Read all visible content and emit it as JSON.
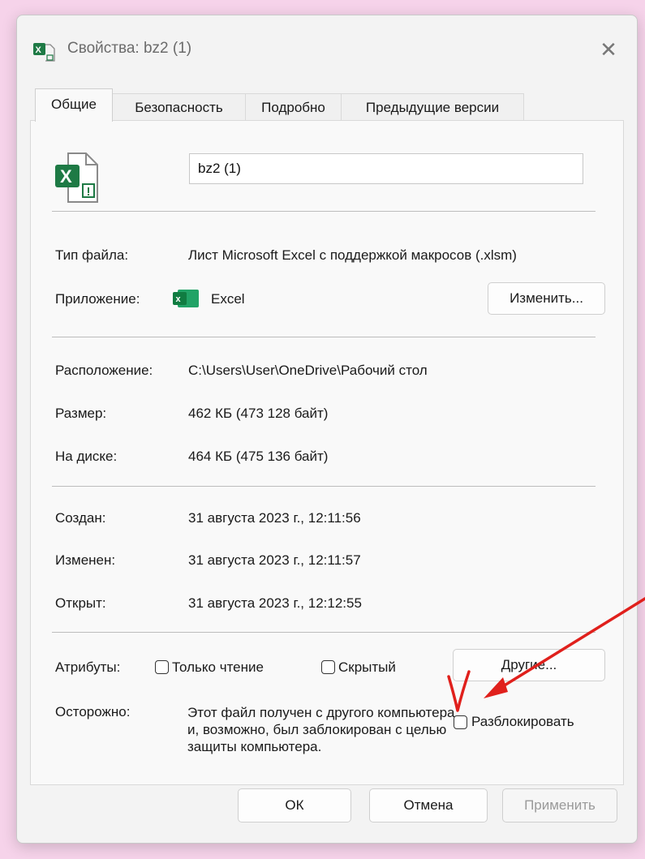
{
  "window": {
    "title": "Свойства: bz2 (1)",
    "close_glyph": "✕"
  },
  "tabs": [
    {
      "label": "Общие",
      "active": true
    },
    {
      "label": "Безопасность",
      "active": false
    },
    {
      "label": "Подробно",
      "active": false
    },
    {
      "label": "Предыдущие версии",
      "active": false
    }
  ],
  "general": {
    "file_name": "bz2 (1)",
    "file_type_label": "Тип файла:",
    "file_type_value": "Лист Microsoft Excel с поддержкой макросов (.xlsm)",
    "app_label": "Приложение:",
    "app_value": "Excel",
    "change_button": "Изменить...",
    "location_label": "Расположение:",
    "location_value": "C:\\Users\\User\\OneDrive\\Рабочий стол",
    "size_label": "Размер:",
    "size_value": "462 КБ (473 128 байт)",
    "disk_label": "На диске:",
    "disk_value": "464 КБ (475 136 байт)",
    "created_label": "Создан:",
    "created_value": "31 августа 2023 г., 12:11:56",
    "modified_label": "Изменен:",
    "modified_value": "31 августа 2023 г., 12:11:57",
    "opened_label": "Открыт:",
    "opened_value": "31 августа 2023 г., 12:12:55",
    "attributes_label": "Атрибуты:",
    "readonly_label": "Только чтение",
    "hidden_label": "Скрытый",
    "other_button": "Другие...",
    "warning_label": "Осторожно:",
    "warning_text": "Этот файл получен с другого компьютера и, возможно, был заблокирован с целью защиты компьютера.",
    "unblock_label": "Разблокировать"
  },
  "footer": {
    "ok": "ОК",
    "cancel": "Отмена",
    "apply": "Применить"
  },
  "annotation": {
    "mark": "V",
    "color": "#e0201c"
  },
  "colors": {
    "excel_green": "#1e7a45",
    "apply_disabled": "#9a9a9a"
  }
}
